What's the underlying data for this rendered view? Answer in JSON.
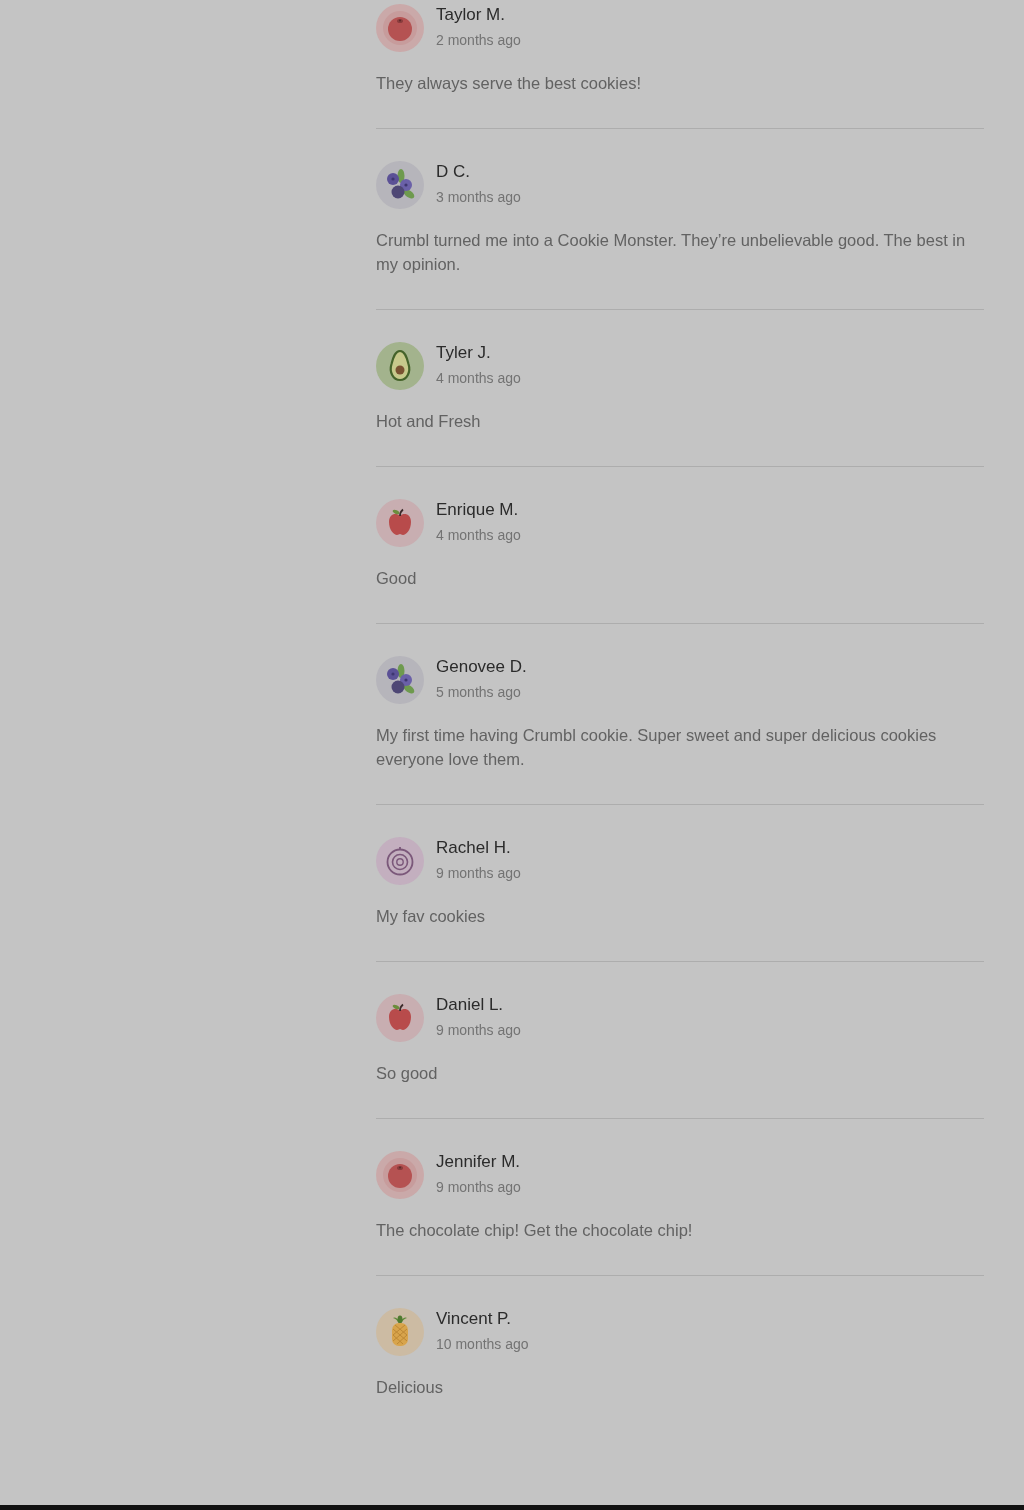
{
  "reviews": [
    {
      "author": "Taylor M.",
      "time": "2 months ago",
      "avatar": {
        "kind": "tomato"
      },
      "text": "They always serve the best cookies!"
    },
    {
      "author": "D C.",
      "time": "3 months ago",
      "avatar": {
        "kind": "blueberries"
      },
      "text": "Crumbl turned me into a Cookie Monster. They’re unbelievable good. The best in my opinion."
    },
    {
      "author": "Tyler J.",
      "time": "4 months ago",
      "avatar": {
        "kind": "avocado"
      },
      "text": "Hot and Fresh"
    },
    {
      "author": "Enrique M.",
      "time": "4 months ago",
      "avatar": {
        "kind": "apple"
      },
      "text": "Good"
    },
    {
      "author": "Genovee D.",
      "time": "5 months ago",
      "avatar": {
        "kind": "blueberries"
      },
      "text": "My first time having Crumbl cookie. Super sweet and super delicious cookies everyone love them."
    },
    {
      "author": "Rachel H.",
      "time": "9 months ago",
      "avatar": {
        "kind": "onion"
      },
      "text": "My fav cookies"
    },
    {
      "author": "Daniel L.",
      "time": "9 months ago",
      "avatar": {
        "kind": "apple"
      },
      "text": "So good"
    },
    {
      "author": "Jennifer M.",
      "time": "9 months ago",
      "avatar": {
        "kind": "tomato"
      },
      "text": "The chocolate chip! Get the chocolate chip!"
    },
    {
      "author": "Vincent P.",
      "time": "10 months ago",
      "avatar": {
        "kind": "pineapple"
      },
      "text": "Delicious"
    }
  ]
}
